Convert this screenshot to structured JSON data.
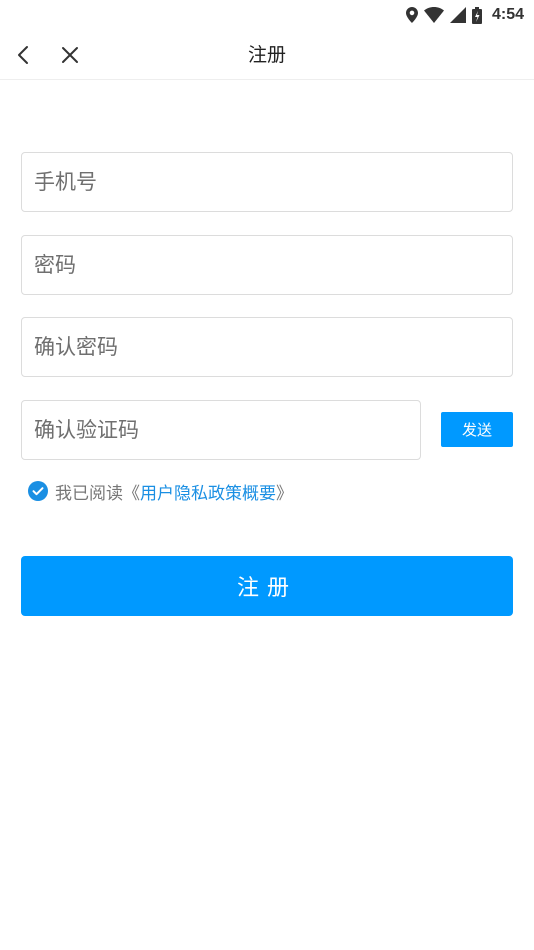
{
  "status_bar": {
    "time": "4:54",
    "icons": [
      "location-icon",
      "wifi-icon",
      "cellular-signal-icon",
      "battery-icon"
    ]
  },
  "nav": {
    "title": "注册",
    "back_icon": "chevron-left-icon",
    "close_icon": "close-icon"
  },
  "form": {
    "phone_placeholder": "手机号",
    "password_placeholder": "密码",
    "confirm_password_placeholder": "确认密码",
    "code_placeholder": "确认验证码",
    "send_label": "发送"
  },
  "agreement": {
    "checked": true,
    "prefix": "我已阅读",
    "open_bracket": "《",
    "link_text": "用户隐私政策概要",
    "close_bracket": "》"
  },
  "submit_label": "注册",
  "colors": {
    "primary": "#0099ff",
    "link": "#1a8fe3",
    "border": "#dcdcdc",
    "placeholder": "#6f6f6f"
  }
}
